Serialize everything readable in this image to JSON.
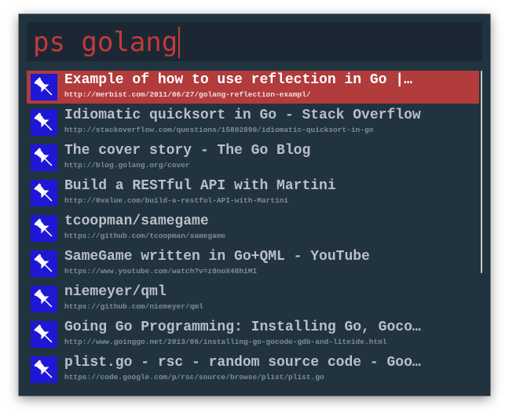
{
  "search": {
    "query": "ps golang"
  },
  "results": [
    {
      "title": "Example of how to use reflection in Go |…",
      "url": "http://merbist.com/2011/06/27/golang-reflection-exampl/",
      "icon": "pin-icon"
    },
    {
      "title": "Idiomatic quicksort in Go - Stack Overflow",
      "url": "http://stackoverflow.com/questions/15802890/idiomatic-quicksort-in-go",
      "icon": "pin-icon"
    },
    {
      "title": "The cover story - The Go Blog",
      "url": "http://blog.golang.org/cover",
      "icon": "pin-icon"
    },
    {
      "title": "Build a RESTful API with Martini",
      "url": "http://0value.com/build-a-restful-API-with-Martini",
      "icon": "pin-icon"
    },
    {
      "title": "tcoopman/samegame",
      "url": "https://github.com/tcoopman/samegame",
      "icon": "pin-icon"
    },
    {
      "title": "SameGame written in Go+QML - YouTube",
      "url": "https://www.youtube.com/watch?v=z8noX48hiMI",
      "icon": "pin-icon"
    },
    {
      "title": "niemeyer/qml",
      "url": "https://github.com/niemeyer/qml",
      "icon": "pin-icon"
    },
    {
      "title": "Going Go Programming: Installing Go, Goco…",
      "url": "http://www.goinggo.net/2013/06/installing-go-gocode-gdb-and-liteide.html",
      "icon": "pin-icon"
    },
    {
      "title": "plist.go - rsc - random source code - Goo…",
      "url": "https://code.google.com/p/rsc/source/browse/plist/plist.go",
      "icon": "pin-icon"
    }
  ],
  "colors": {
    "background": "#223340",
    "search_bg": "#1b2833",
    "query_text": "#c23a3a",
    "selected_row": "#b23b3b",
    "icon_bg": "#1e17d6"
  }
}
